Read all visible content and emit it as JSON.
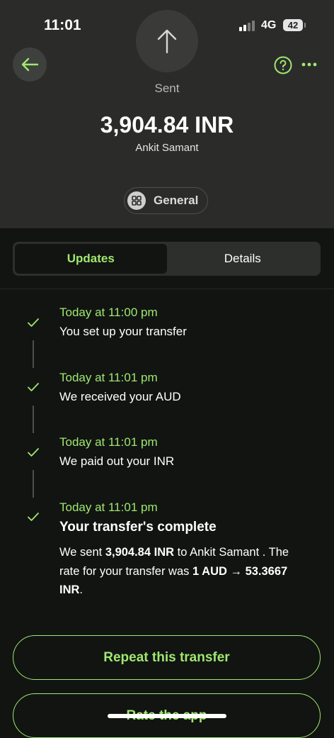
{
  "status_bar": {
    "time": "11:01",
    "network": "4G",
    "battery": "42"
  },
  "header": {
    "status_label": "Sent",
    "amount": "3,904.84 INR",
    "recipient": "Ankit Samant",
    "category": "General"
  },
  "tabs": [
    {
      "label": "Updates",
      "active": true
    },
    {
      "label": "Details",
      "active": false
    }
  ],
  "timeline": [
    {
      "time": "Today at 11:00 pm",
      "title": "You set up your transfer"
    },
    {
      "time": "Today at 11:01 pm",
      "title": "We received your AUD"
    },
    {
      "time": "Today at 11:01 pm",
      "title": "We paid out your INR"
    },
    {
      "time": "Today at 11:01 pm",
      "title": "Your transfer's complete",
      "desc_parts": [
        "We sent ",
        "3,904.84 INR",
        " to Ankit Samant . The rate for your transfer was ",
        "1 AUD → 53.3667 INR",
        "."
      ]
    }
  ],
  "buttons": {
    "repeat": "Repeat this transfer",
    "rate": "Rate the app"
  },
  "colors": {
    "accent": "#9fe870",
    "background": "#121411",
    "header_bg": "#2b2c2a"
  }
}
